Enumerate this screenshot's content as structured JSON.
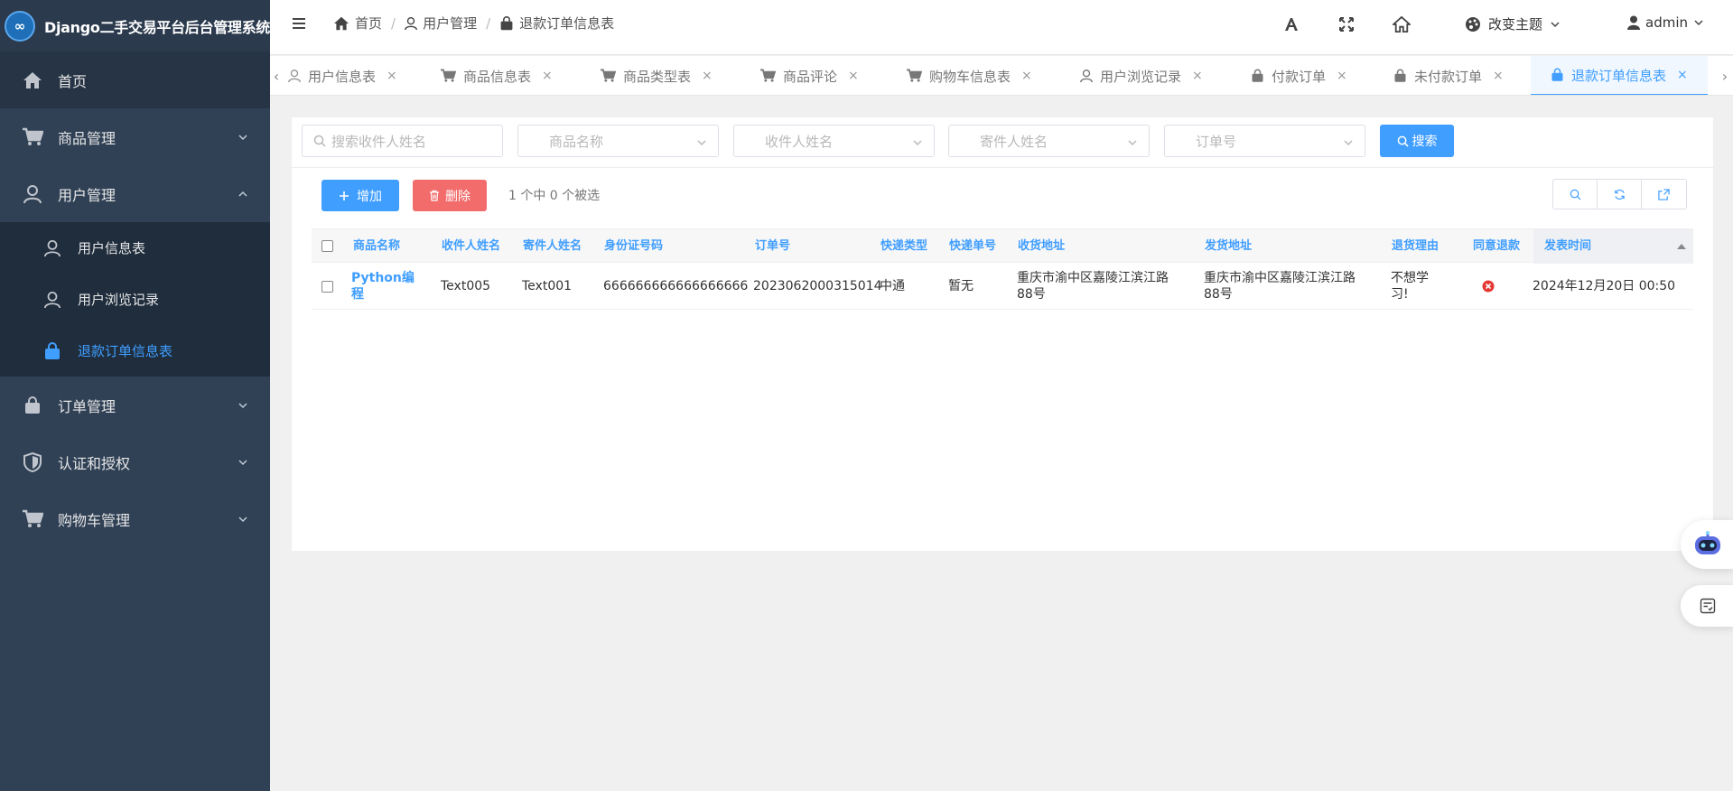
{
  "app": {
    "title": "Django二手交易平台后台管理系统",
    "logo_glyph": "∞",
    "accent_color": "#409eff",
    "sidebar_bg": "#304156"
  },
  "sidebar": {
    "home": {
      "label": "首页",
      "icon": "home-icon"
    },
    "goods": {
      "label": "商品管理",
      "icon": "cart-icon"
    },
    "users": {
      "label": "用户管理",
      "icon": "user-icon"
    },
    "users_children": [
      {
        "label": "用户信息表",
        "icon": "user-icon"
      },
      {
        "label": "用户浏览记录",
        "icon": "user-icon"
      },
      {
        "label": "退款订单信息表",
        "icon": "shopping-bag-icon",
        "active": true
      }
    ],
    "orders": {
      "label": "订单管理",
      "icon": "shopping-bag-icon"
    },
    "auth": {
      "label": "认证和授权",
      "icon": "shield-icon"
    },
    "cart": {
      "label": "购物车管理",
      "icon": "cart-icon"
    }
  },
  "navbar": {
    "breadcrumb": [
      {
        "label": "首页",
        "icon": "home-icon"
      },
      {
        "label": "用户管理",
        "icon": "user-icon"
      },
      {
        "label": "退款订单信息表",
        "icon": "shopping-bag-icon"
      }
    ],
    "separator": "/",
    "theme_label": "改变主题",
    "user_label": "admin"
  },
  "tabs": [
    {
      "label": "用户信息表",
      "icon": "user-icon"
    },
    {
      "label": "商品信息表",
      "icon": "cart-icon"
    },
    {
      "label": "商品类型表",
      "icon": "cart-icon"
    },
    {
      "label": "商品评论",
      "icon": "cart-icon"
    },
    {
      "label": "购物车信息表",
      "icon": "cart-icon"
    },
    {
      "label": "用户浏览记录",
      "icon": "user-icon"
    },
    {
      "label": "付款订单",
      "icon": "shopping-bag-icon"
    },
    {
      "label": "未付款订单",
      "icon": "shopping-bag-icon"
    },
    {
      "label": "退款订单信息表",
      "icon": "shopping-bag-icon",
      "active": true
    }
  ],
  "tab_close_glyph": "×",
  "filters": {
    "search_placeholder": "搜索收件人姓名",
    "goods_name_placeholder": "商品名称",
    "receiver_placeholder": "收件人姓名",
    "sender_placeholder": "寄件人姓名",
    "order_no_placeholder": "订单号",
    "search_button": "搜索"
  },
  "actions": {
    "add_label": "增加",
    "delete_label": "删除",
    "selection_count": "1 个中 0 个被选"
  },
  "table": {
    "columns": [
      "商品名称",
      "收件人姓名",
      "寄件人姓名",
      "身份证号码",
      "订单号",
      "快递类型",
      "快递单号",
      "收货地址",
      "发货地址",
      "退货理由",
      "同意退款",
      "发表时间"
    ],
    "rows": [
      {
        "goods_name": [
          "Python编",
          "程"
        ],
        "receiver": "Text005",
        "sender": "Text001",
        "id_number": "666666666666666666",
        "order_no": "2023062000315014",
        "express_type": "中通",
        "express_no": "暂无",
        "receive_address": [
          "重庆市渝中区嘉陵江滨江路",
          "88号"
        ],
        "send_address": [
          "重庆市渝中区嘉陵江滨江路",
          "88号"
        ],
        "reason": [
          "不想学",
          "习!"
        ],
        "agree_refund": "no",
        "publish_time": "2024年12月20日 00:50"
      }
    ]
  }
}
